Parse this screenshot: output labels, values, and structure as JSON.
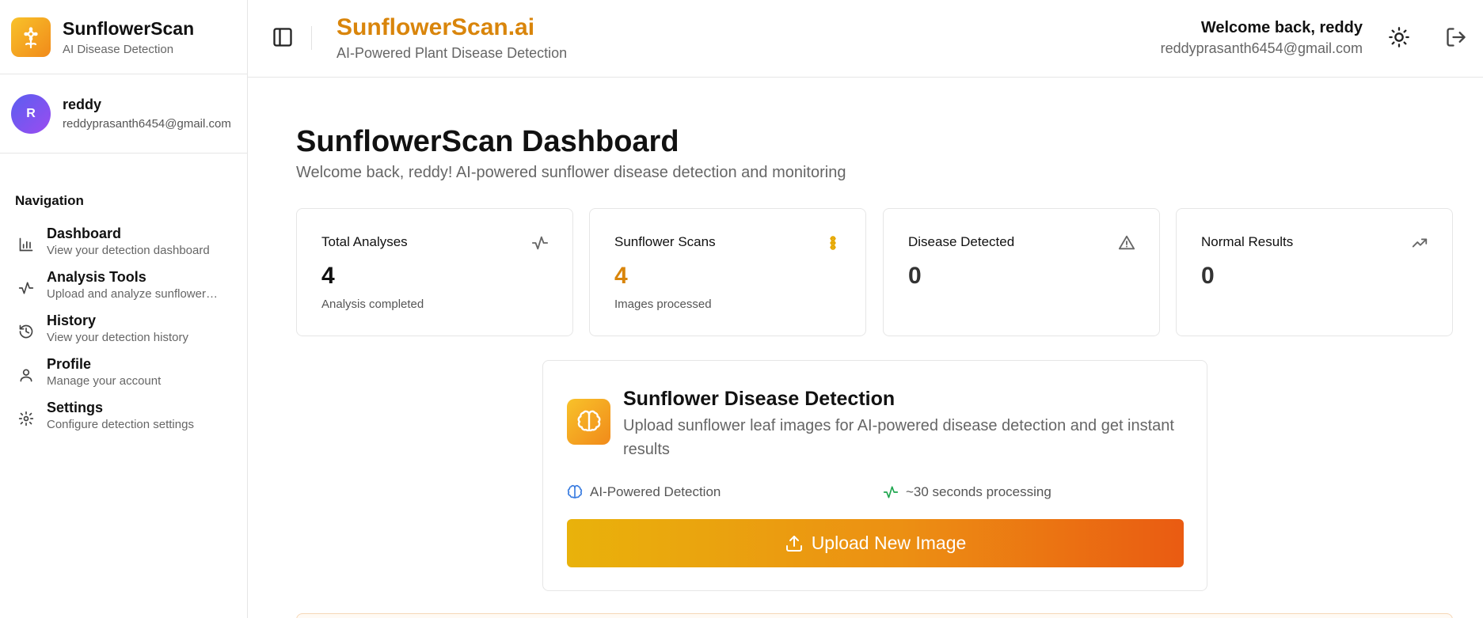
{
  "sidebar": {
    "brand_title": "SunflowerScan",
    "brand_subtitle": "AI Disease Detection",
    "user": {
      "initial": "R",
      "name": "reddy",
      "email": "reddyprasanth6454@gmail.com"
    },
    "nav_heading": "Navigation",
    "items": [
      {
        "title": "Dashboard",
        "desc": "View your detection dashboard",
        "icon": "bar-chart-icon"
      },
      {
        "title": "Analysis Tools",
        "desc": "Upload and analyze sunflower …",
        "icon": "activity-icon"
      },
      {
        "title": "History",
        "desc": "View your detection history",
        "icon": "history-icon"
      },
      {
        "title": "Profile",
        "desc": "Manage your account",
        "icon": "user-icon"
      },
      {
        "title": "Settings",
        "desc": "Configure detection settings",
        "icon": "gear-icon"
      }
    ]
  },
  "header": {
    "title": "SunflowerScan.ai",
    "subtitle": "AI-Powered Plant Disease Detection",
    "welcome": "Welcome back, reddy",
    "email": "reddyprasanth6454@gmail.com"
  },
  "main": {
    "title": "SunflowerScan Dashboard",
    "subtitle": "Welcome back, reddy! AI-powered sunflower disease detection and monitoring",
    "stats": [
      {
        "label": "Total Analyses",
        "value": "4",
        "note": "Analysis completed",
        "icon": "activity-icon"
      },
      {
        "label": "Sunflower Scans",
        "value": "4",
        "note": "Images processed",
        "icon": "flower-icon"
      },
      {
        "label": "Disease Detected",
        "value": "0",
        "note": "",
        "icon": "alert-triangle-icon"
      },
      {
        "label": "Normal Results",
        "value": "0",
        "note": "",
        "icon": "trending-up-icon"
      }
    ],
    "detection": {
      "title": "Sunflower Disease Detection",
      "description": "Upload sunflower leaf images for AI-powered disease detection and get instant results",
      "feature_1": "AI-Powered Detection",
      "feature_2": "~30 seconds processing",
      "upload_label": "Upload New Image"
    }
  },
  "colors": {
    "brand_orange": "#d9850b",
    "accent_gradient_start": "#e9b20b",
    "accent_gradient_end": "#ea5b12",
    "avatar_gradient_start": "#5b5ef0",
    "avatar_gradient_end": "#9b4cf0"
  }
}
